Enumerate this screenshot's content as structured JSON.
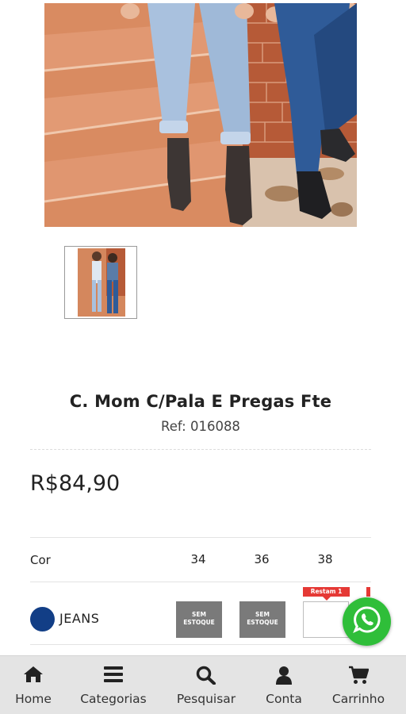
{
  "product": {
    "name": "C. Mom C/Pala E Pregas Fte",
    "ref": "Ref: 016088",
    "price": "R$84,90"
  },
  "variations": {
    "color_header": "Cor",
    "sizes": [
      "34",
      "36",
      "38"
    ],
    "rows": [
      {
        "color_name": "JEANS",
        "color_swatch": "#123e86",
        "cells": [
          {
            "size": "34",
            "status": "SEM ESTOQUE"
          },
          {
            "size": "36",
            "status": "SEM ESTOQUE"
          },
          {
            "size": "38",
            "badge": "Restam 1",
            "quantity": ""
          }
        ]
      }
    ],
    "out_of_stock_line1": "SEM",
    "out_of_stock_line2": "ESTOQUE"
  },
  "whatsapp": {
    "icon": "whatsapp-icon",
    "color": "#2fbe39"
  },
  "nav": {
    "items": [
      {
        "label": "Home",
        "icon": "home-icon"
      },
      {
        "label": "Categorias",
        "icon": "menu-icon"
      },
      {
        "label": "Pesquisar",
        "icon": "search-icon"
      },
      {
        "label": "Conta",
        "icon": "user-icon"
      },
      {
        "label": "Carrinho",
        "icon": "cart-icon"
      }
    ]
  },
  "colors": {
    "badge_red": "#e53935",
    "out_of_stock_gray": "#7a7a7a",
    "nav_bg": "#e4e4e4"
  }
}
